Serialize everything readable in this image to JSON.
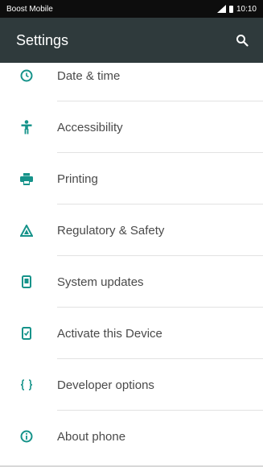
{
  "status_bar": {
    "carrier": "Boost Mobile",
    "time": "10:10"
  },
  "header": {
    "title": "Settings"
  },
  "items": [
    {
      "label": "Date & time",
      "icon": "clock-icon"
    },
    {
      "label": "Accessibility",
      "icon": "accessibility-icon"
    },
    {
      "label": "Printing",
      "icon": "printer-icon"
    },
    {
      "label": "Regulatory & Safety",
      "icon": "regulatory-icon"
    },
    {
      "label": "System updates",
      "icon": "system-update-icon"
    },
    {
      "label": "Activate this Device",
      "icon": "activate-device-icon"
    },
    {
      "label": "Developer options",
      "icon": "code-braces-icon"
    },
    {
      "label": "About phone",
      "icon": "info-icon"
    }
  ],
  "colors": {
    "accent": "#16938a",
    "app_bar": "#2f3a3c",
    "status_bar": "#0d0d0d"
  }
}
